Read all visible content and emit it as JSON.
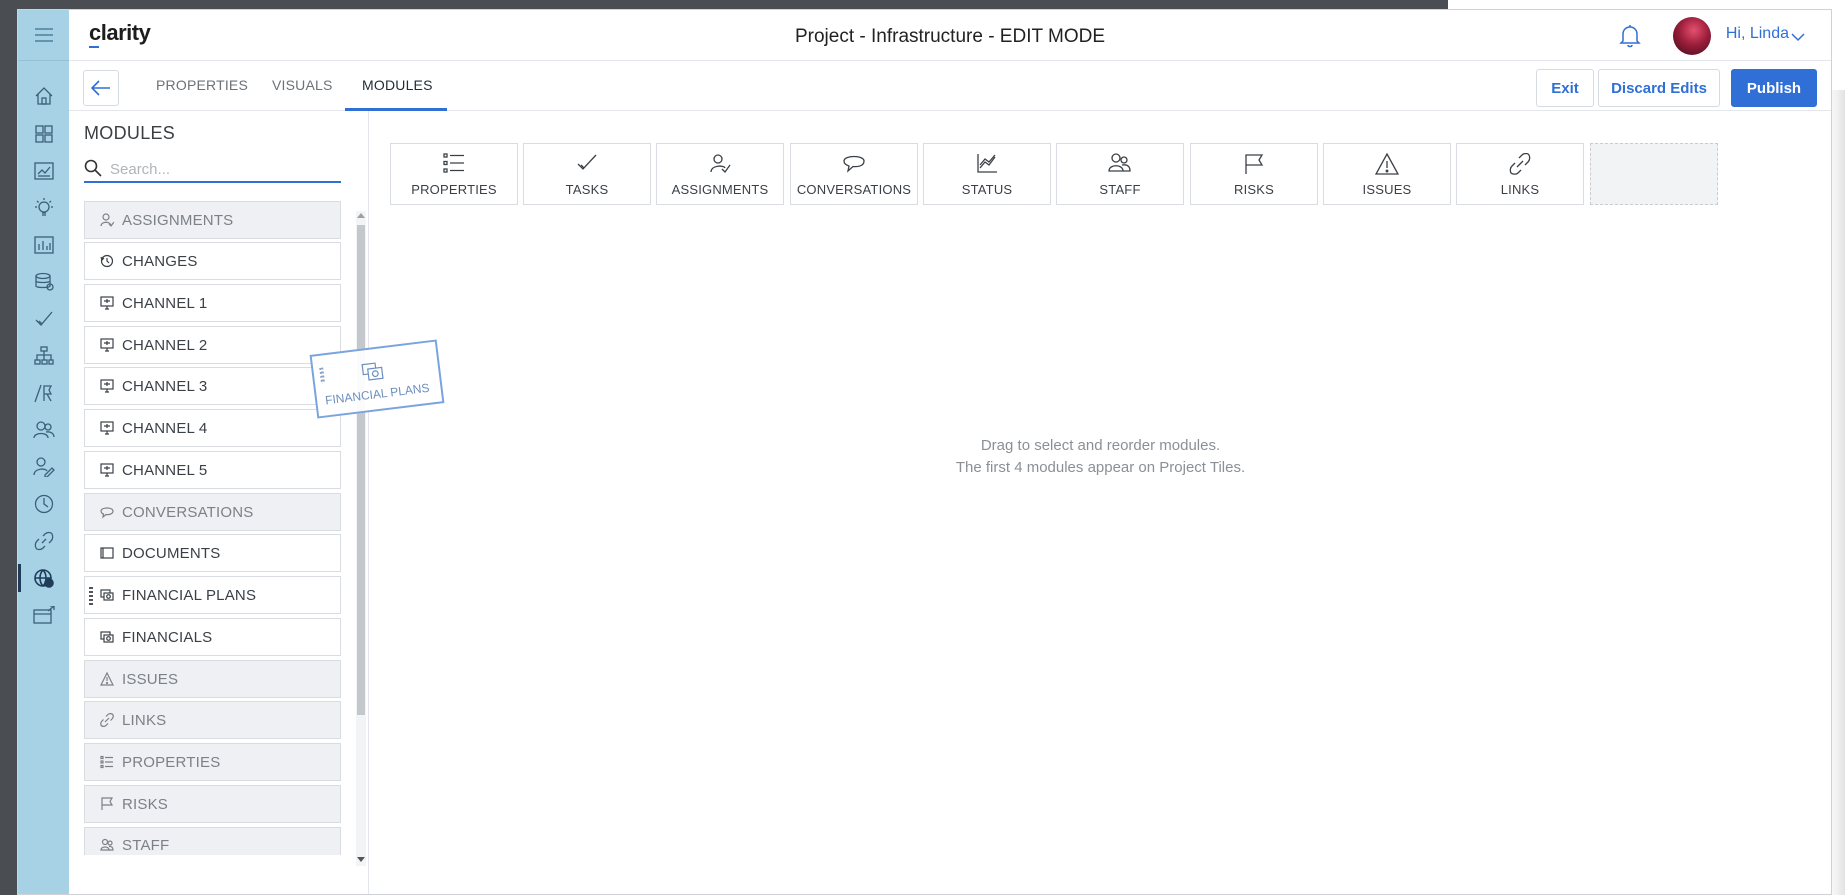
{
  "app": {
    "logo": "clarity",
    "page_title": "Project - Infrastructure - EDIT MODE",
    "greeting": "Hi, Linda",
    "accent_color": "#2f6fd6",
    "rail_color": "#a7d2e6"
  },
  "rail": {
    "icons": [
      "menu-icon",
      "home-icon",
      "grid-icon",
      "chart-board-icon",
      "idea-icon",
      "bar-chart-icon",
      "database-icon",
      "check-icon",
      "hierarchy-icon",
      "roadmap-icon",
      "team-icon",
      "user-edit-icon",
      "clock-icon",
      "link-icon",
      "globe-money-icon",
      "inbox-icon"
    ],
    "active_index": 14
  },
  "tabs": {
    "items": [
      {
        "label": "PROPERTIES"
      },
      {
        "label": "VISUALS"
      },
      {
        "label": "MODULES"
      }
    ],
    "active_index": 2
  },
  "actions": {
    "exit_label": "Exit",
    "discard_label": "Discard Edits",
    "publish_label": "Publish"
  },
  "panel": {
    "title": "MODULES",
    "search_placeholder": "Search...",
    "items": [
      {
        "label": "ASSIGNMENTS",
        "icon": "assignment-icon",
        "used": true
      },
      {
        "label": "CHANGES",
        "icon": "changes-icon",
        "used": false
      },
      {
        "label": "CHANNEL 1",
        "icon": "channel-icon",
        "used": false
      },
      {
        "label": "CHANNEL 2",
        "icon": "channel-icon",
        "used": false
      },
      {
        "label": "CHANNEL 3",
        "icon": "channel-icon",
        "used": false
      },
      {
        "label": "CHANNEL 4",
        "icon": "channel-icon",
        "used": false
      },
      {
        "label": "CHANNEL 5",
        "icon": "channel-icon",
        "used": false
      },
      {
        "label": "CONVERSATIONS",
        "icon": "conversation-icon",
        "used": true
      },
      {
        "label": "DOCUMENTS",
        "icon": "documents-icon",
        "used": false
      },
      {
        "label": "FINANCIAL PLANS",
        "icon": "financial-icon",
        "used": false
      },
      {
        "label": "FINANCIALS",
        "icon": "financial-icon",
        "used": false
      },
      {
        "label": "ISSUES",
        "icon": "warning-icon",
        "used": true
      },
      {
        "label": "LINKS",
        "icon": "link-icon",
        "used": true
      },
      {
        "label": "PROPERTIES",
        "icon": "list-icon",
        "used": true
      },
      {
        "label": "RISKS",
        "icon": "flag-icon",
        "used": true
      },
      {
        "label": "STAFF",
        "icon": "staff-icon",
        "used": true
      }
    ]
  },
  "drag_ghost": {
    "label": "FINANCIAL PLANS"
  },
  "tiles": [
    {
      "label": "PROPERTIES",
      "icon": "list-icon"
    },
    {
      "label": "TASKS",
      "icon": "check-icon"
    },
    {
      "label": "ASSIGNMENTS",
      "icon": "assignment-icon"
    },
    {
      "label": "CONVERSATIONS",
      "icon": "conversation-icon"
    },
    {
      "label": "STATUS",
      "icon": "status-chart-icon"
    },
    {
      "label": "STAFF",
      "icon": "staff-icon"
    },
    {
      "label": "RISKS",
      "icon": "flag-icon"
    },
    {
      "label": "ISSUES",
      "icon": "warning-icon"
    },
    {
      "label": "LINKS",
      "icon": "link-icon"
    }
  ],
  "hint": {
    "line1": "Drag to select and reorder modules.",
    "line2": "The first 4 modules appear on Project Tiles."
  }
}
